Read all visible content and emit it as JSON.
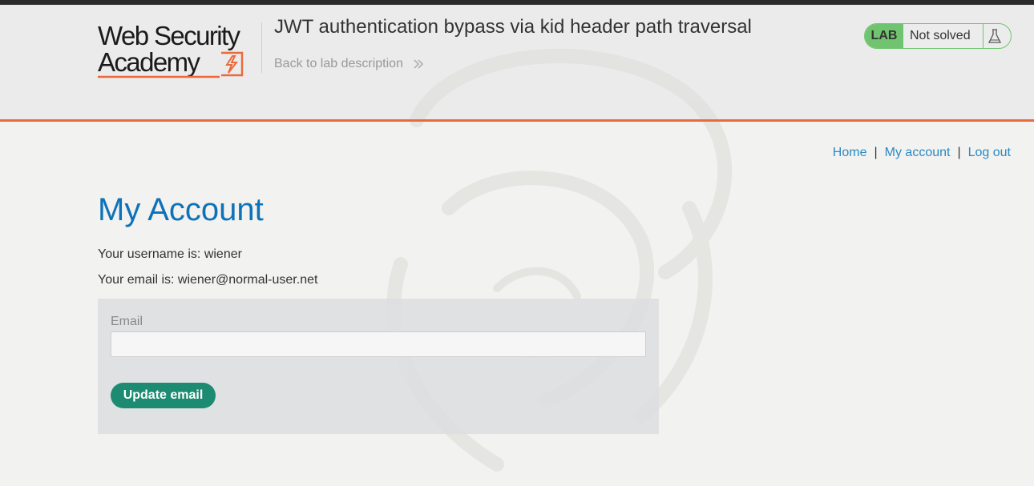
{
  "header": {
    "logo_line1": "Web Security",
    "logo_line2": "Academy",
    "lab_title": "JWT authentication bypass via kid header path traversal",
    "back_link": "Back to lab description",
    "status": {
      "badge": "LAB",
      "text": "Not solved",
      "icon": "flask-icon"
    }
  },
  "nav": {
    "items": [
      "Home",
      "My account",
      "Log out"
    ],
    "separator": "|"
  },
  "main": {
    "title": "My Account",
    "username_line": "Your username is: wiener",
    "email_line": "Your email is: wiener@normal-user.net",
    "form": {
      "email_label": "Email",
      "email_value": "",
      "submit_label": "Update email"
    }
  },
  "colors": {
    "accent_orange": "#ea6a3c",
    "link_blue": "#2a8ac4",
    "title_blue": "#0e72b8",
    "button_green": "#1d8a72",
    "status_green": "#70c470"
  }
}
